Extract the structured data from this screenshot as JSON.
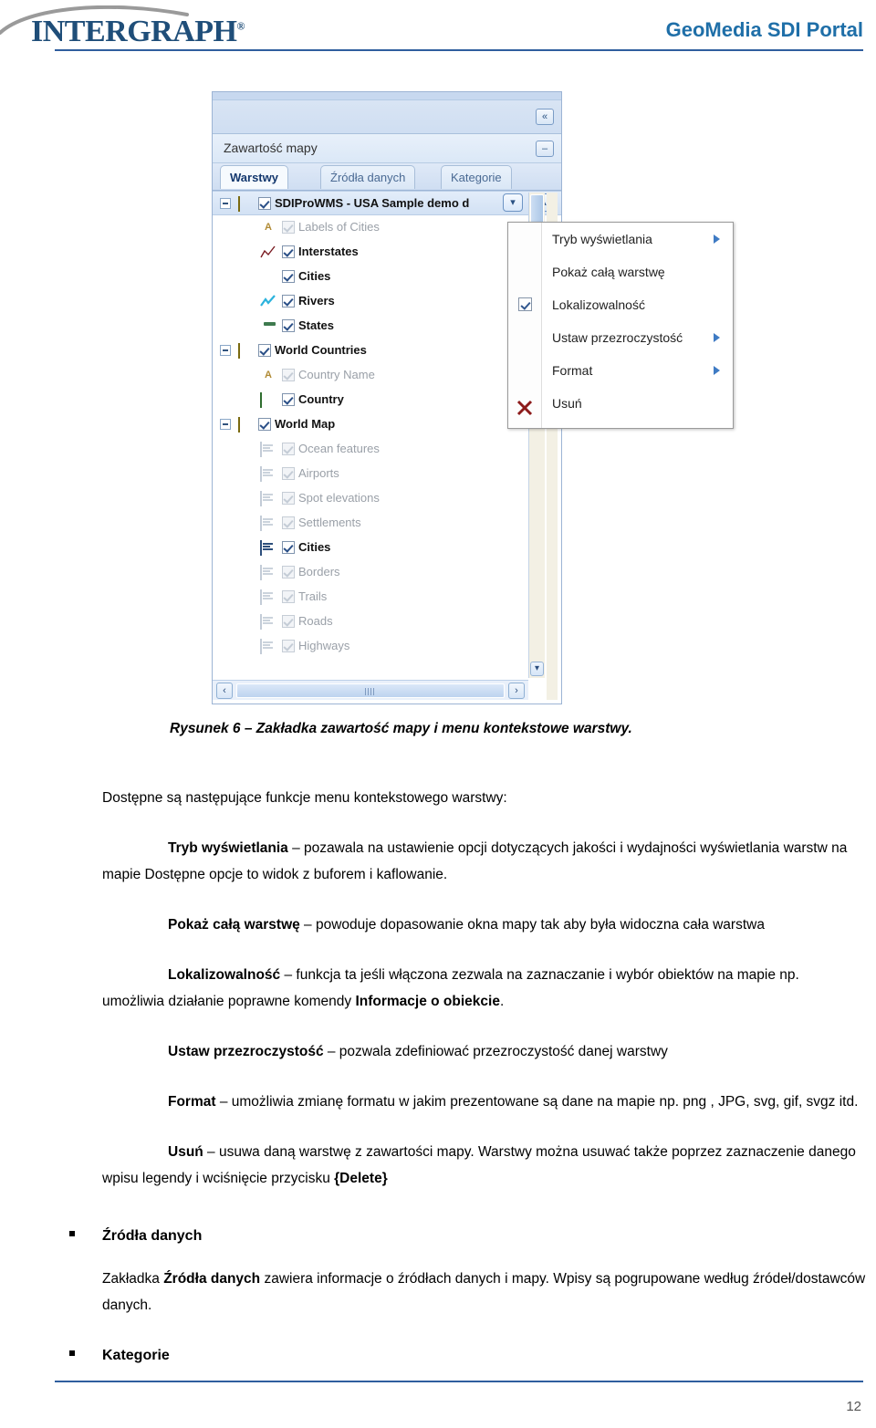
{
  "header": {
    "brand": "INTERGRAPH",
    "brand_reg": "®",
    "portal_title": "GeoMedia SDI Portal"
  },
  "screenshot": {
    "toolbar": {
      "collapse_all_label": "«",
      "minimize_label": "–"
    },
    "panel_title": "Zawartość mapy",
    "tabs": [
      {
        "label": "Warstwy",
        "active": true
      },
      {
        "label": "Źródła danych",
        "active": false
      },
      {
        "label": "Kategorie",
        "active": false
      }
    ],
    "tree": [
      {
        "label": "SDIProWMS - USA Sample demo d",
        "level": 0,
        "checked": true,
        "dim": false,
        "bold": true,
        "icon": "parallelogram-icon",
        "expander": true,
        "selected": true
      },
      {
        "label": "Labels of Cities",
        "level": 1,
        "checked": true,
        "dim": true,
        "bold": false,
        "icon": "label-a-icon",
        "expander": false,
        "selected": false
      },
      {
        "label": "Interstates",
        "level": 1,
        "checked": true,
        "dim": false,
        "bold": true,
        "icon": "dark-line-icon",
        "expander": false,
        "selected": false
      },
      {
        "label": "Cities",
        "level": 1,
        "checked": true,
        "dim": false,
        "bold": true,
        "icon": "point-icon",
        "expander": false,
        "selected": false
      },
      {
        "label": "Rivers",
        "level": 1,
        "checked": true,
        "dim": false,
        "bold": true,
        "icon": "blue-line-icon",
        "expander": false,
        "selected": false
      },
      {
        "label": "States",
        "level": 1,
        "checked": true,
        "dim": false,
        "bold": true,
        "icon": "state-fill-icon",
        "expander": false,
        "selected": false
      },
      {
        "label": "World Countries",
        "level": 0,
        "checked": true,
        "dim": false,
        "bold": true,
        "icon": "parallelogram-icon",
        "expander": true,
        "selected": false
      },
      {
        "label": "Country Name",
        "level": 1,
        "checked": true,
        "dim": true,
        "bold": false,
        "icon": "label-a-icon",
        "expander": false,
        "selected": false
      },
      {
        "label": "Country",
        "level": 1,
        "checked": true,
        "dim": false,
        "bold": true,
        "icon": "area-fill-icon",
        "expander": false,
        "selected": false
      },
      {
        "label": "World Map",
        "level": 0,
        "checked": true,
        "dim": false,
        "bold": true,
        "icon": "parallelogram-icon",
        "expander": true,
        "selected": false
      },
      {
        "label": "Ocean features",
        "level": 1,
        "checked": true,
        "dim": true,
        "bold": false,
        "icon": "wms-layer-icon",
        "expander": false,
        "selected": false
      },
      {
        "label": "Airports",
        "level": 1,
        "checked": true,
        "dim": true,
        "bold": false,
        "icon": "wms-layer-icon",
        "expander": false,
        "selected": false
      },
      {
        "label": "Spot elevations",
        "level": 1,
        "checked": true,
        "dim": true,
        "bold": false,
        "icon": "wms-layer-icon",
        "expander": false,
        "selected": false
      },
      {
        "label": "Settlements",
        "level": 1,
        "checked": true,
        "dim": true,
        "bold": false,
        "icon": "wms-layer-icon",
        "expander": false,
        "selected": false
      },
      {
        "label": "Cities",
        "level": 1,
        "checked": true,
        "dim": false,
        "bold": true,
        "icon": "wms-layer-icon-active",
        "expander": false,
        "selected": false
      },
      {
        "label": "Borders",
        "level": 1,
        "checked": true,
        "dim": true,
        "bold": false,
        "icon": "wms-layer-icon",
        "expander": false,
        "selected": false
      },
      {
        "label": "Trails",
        "level": 1,
        "checked": true,
        "dim": true,
        "bold": false,
        "icon": "wms-layer-icon",
        "expander": false,
        "selected": false
      },
      {
        "label": "Roads",
        "level": 1,
        "checked": true,
        "dim": true,
        "bold": false,
        "icon": "wms-layer-icon",
        "expander": false,
        "selected": false
      },
      {
        "label": "Highways",
        "level": 1,
        "checked": true,
        "dim": true,
        "bold": false,
        "icon": "wms-layer-icon",
        "expander": false,
        "selected": false
      }
    ],
    "row_buttons": {
      "move_down": "▾",
      "separator": "ı",
      "move_up": "▴"
    },
    "scroll": {
      "down_arrow": "▾",
      "left_arrow": "‹",
      "right_arrow": "›"
    },
    "context_menu": [
      {
        "label": "Tryb wyświetlania",
        "submenu": true,
        "checkbox": false,
        "delete_icon": false
      },
      {
        "label": "Pokaż całą warstwę",
        "submenu": false,
        "checkbox": false,
        "delete_icon": false
      },
      {
        "label": "Lokalizowalność",
        "submenu": false,
        "checkbox": true,
        "delete_icon": false
      },
      {
        "label": "Ustaw przezroczystość",
        "submenu": true,
        "checkbox": false,
        "delete_icon": false
      },
      {
        "label": "Format",
        "submenu": true,
        "checkbox": false,
        "delete_icon": false
      },
      {
        "label": "Usuń",
        "submenu": false,
        "checkbox": false,
        "delete_icon": true
      }
    ]
  },
  "document": {
    "caption": "Rysunek 6 – Zakładka zawartość mapy i menu kontekstowe warstwy.",
    "intro": "Dostępne są następujące funkcje menu kontekstowego warstwy:",
    "items": [
      {
        "term": "Tryb wyświetlania",
        "rest": " – pozawala na ustawienie opcji dotyczących jakości i wydajności wyświetlania warstw na mapie  Dostępne opcje to widok z buforem i kaflowanie."
      },
      {
        "term": "Pokaż całą warstwę",
        "rest": " – powoduje dopasowanie okna mapy tak aby była widoczna cała warstwa"
      },
      {
        "term": "Lokalizowalność",
        "rest": " – funkcja ta jeśli włączona zezwala na zaznaczanie i wybór obiektów na mapie np. umożliwia działanie poprawne  komendy ",
        "rest_bold": "Informacje o obiekcie",
        "rest_tail": "."
      },
      {
        "term": "Ustaw przezroczystość",
        "rest": " – pozwala zdefiniować przezroczystość danej warstwy"
      },
      {
        "term": "Format",
        "rest": " – umożliwia zmianę formatu w jakim prezentowane są dane na mapie np. png , JPG, svg, gif, svgz itd."
      },
      {
        "term": "Usuń",
        "rest": " – usuwa daną warstwę z zawartości mapy. Warstwy można usuwać także poprzez zaznaczenie danego wpisu legendy i wciśnięcie przycisku ",
        "rest_bold": "{Delete}",
        "rest_tail": ""
      }
    ],
    "bullets": [
      {
        "title": "Źródła danych",
        "para_pre": "Zakładka ",
        "para_bold": "Źródła danych",
        "para_post": " zawiera informacje o źródłach danych i mapy. Wpisy są pogrupowane według  źródeł/dostawców danych."
      },
      {
        "title": "Kategorie",
        "para_pre": "",
        "para_bold": "",
        "para_post": ""
      }
    ],
    "page_number": "12"
  },
  "colors": {
    "brand_blue": "#1F4E79",
    "portal_blue": "#1F6FA8",
    "rule_blue": "#2F5E9E"
  }
}
